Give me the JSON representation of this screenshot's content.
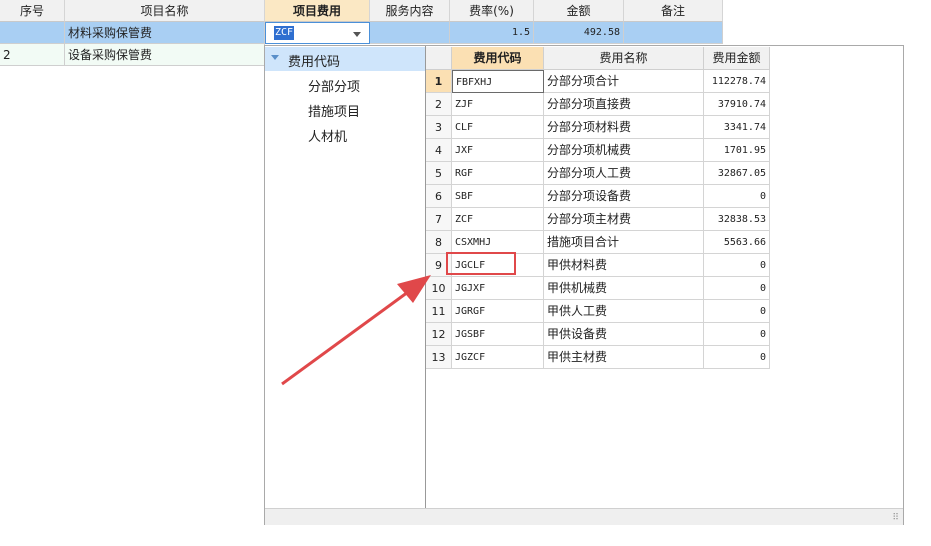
{
  "columns": {
    "seq": "序号",
    "name": "项目名称",
    "fee": "项目费用",
    "service": "服务内容",
    "rate": "费率(%)",
    "amount": "金额",
    "remark": "备注"
  },
  "rows": [
    {
      "seq": "",
      "name": "材料采购保管费",
      "fee": "ZCF",
      "service": "",
      "rate": "1.5",
      "amount": "492.58",
      "remark": ""
    },
    {
      "seq": "2",
      "name": "设备采购保管费",
      "fee": "",
      "service": "",
      "rate": "",
      "amount": "",
      "remark": ""
    }
  ],
  "tree": {
    "root": "费用代码",
    "children": [
      "分部分项",
      "措施项目",
      "人材机"
    ]
  },
  "subtable": {
    "headers": {
      "code": "费用代码",
      "name": "费用名称",
      "amount": "费用金额"
    },
    "rows": [
      {
        "n": "1",
        "code": "FBFXHJ",
        "name": "分部分项合计",
        "amount": "112278.74"
      },
      {
        "n": "2",
        "code": "ZJF",
        "name": "分部分项直接费",
        "amount": "37910.74"
      },
      {
        "n": "3",
        "code": "CLF",
        "name": "分部分项材料费",
        "amount": "3341.74"
      },
      {
        "n": "4",
        "code": "JXF",
        "name": "分部分项机械费",
        "amount": "1701.95"
      },
      {
        "n": "5",
        "code": "RGF",
        "name": "分部分项人工费",
        "amount": "32867.05"
      },
      {
        "n": "6",
        "code": "SBF",
        "name": "分部分项设备费",
        "amount": "0"
      },
      {
        "n": "7",
        "code": "ZCF",
        "name": "分部分项主材费",
        "amount": "32838.53"
      },
      {
        "n": "8",
        "code": "CSXMHJ",
        "name": "措施项目合计",
        "amount": "5563.66"
      },
      {
        "n": "9",
        "code": "JGCLF",
        "name": "甲供材料费",
        "amount": "0"
      },
      {
        "n": "10",
        "code": "JGJXF",
        "name": "甲供机械费",
        "amount": "0"
      },
      {
        "n": "11",
        "code": "JGRGF",
        "name": "甲供人工费",
        "amount": "0"
      },
      {
        "n": "12",
        "code": "JGSBF",
        "name": "甲供设备费",
        "amount": "0"
      },
      {
        "n": "13",
        "code": "JGZCF",
        "name": "甲供主材费",
        "amount": "0"
      }
    ]
  },
  "colors": {
    "annotation": "#e0484a",
    "selected_row": "#a9cff3",
    "active_header": "#fbe8c4"
  },
  "icons": [
    "dropdown-arrow-icon",
    "tree-expand-icon",
    "resize-grip-icon",
    "annotation-arrow"
  ]
}
